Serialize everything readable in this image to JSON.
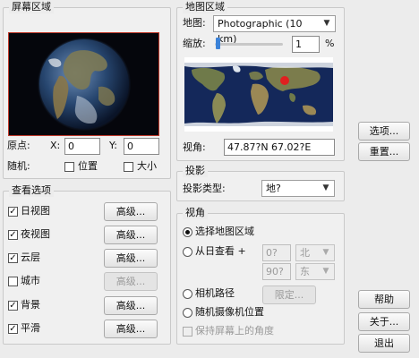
{
  "screen_area": {
    "title": "屏幕区域",
    "origin_label": "原点:",
    "x_label": "X:",
    "x_value": "0",
    "y_label": "Y:",
    "y_value": "0",
    "random_label": "随机:",
    "position_label": "位置",
    "size_label": "大小"
  },
  "view_options": {
    "title": "查看选项",
    "advanced_label": "高级...",
    "items": [
      {
        "label": "日视图",
        "checked": true,
        "advanced_enabled": true
      },
      {
        "label": "夜视图",
        "checked": true,
        "advanced_enabled": true
      },
      {
        "label": "云层",
        "checked": true,
        "advanced_enabled": true
      },
      {
        "label": "城市",
        "checked": false,
        "advanced_enabled": false
      },
      {
        "label": "背景",
        "checked": true,
        "advanced_enabled": true
      },
      {
        "label": "平滑",
        "checked": true,
        "advanced_enabled": true
      }
    ]
  },
  "map_area": {
    "title": "地图区域",
    "map_label": "地图:",
    "map_value": "Photographic (10 km)",
    "zoom_label": "缩放:",
    "zoom_value": "1",
    "zoom_unit": "%",
    "zoom_level": 0.02,
    "view_angle_label": "视角:",
    "view_angle_value": "47.87?N   67.02?E"
  },
  "projection": {
    "title": "投影",
    "type_label": "投影类型:",
    "type_value": "地?"
  },
  "viewpoint": {
    "title": "视角",
    "opt_map_area": "选择地图区域",
    "opt_from_sun": "从日查看 +",
    "lat_value": "0?",
    "lat_dir": "北",
    "lon_value": "90?",
    "lon_dir": "东",
    "opt_camera_path": "相机路径",
    "limit_label": "限定...",
    "opt_random_camera": "随机摄像机位置",
    "keep_angle": "保持屏幕上的角度"
  },
  "right_buttons": {
    "options": "选项...",
    "reset": "重置...",
    "help": "帮助",
    "about": "关于...",
    "exit": "退出"
  },
  "colors": {
    "marker": "#e02020",
    "preview_border": "#c0392b"
  }
}
